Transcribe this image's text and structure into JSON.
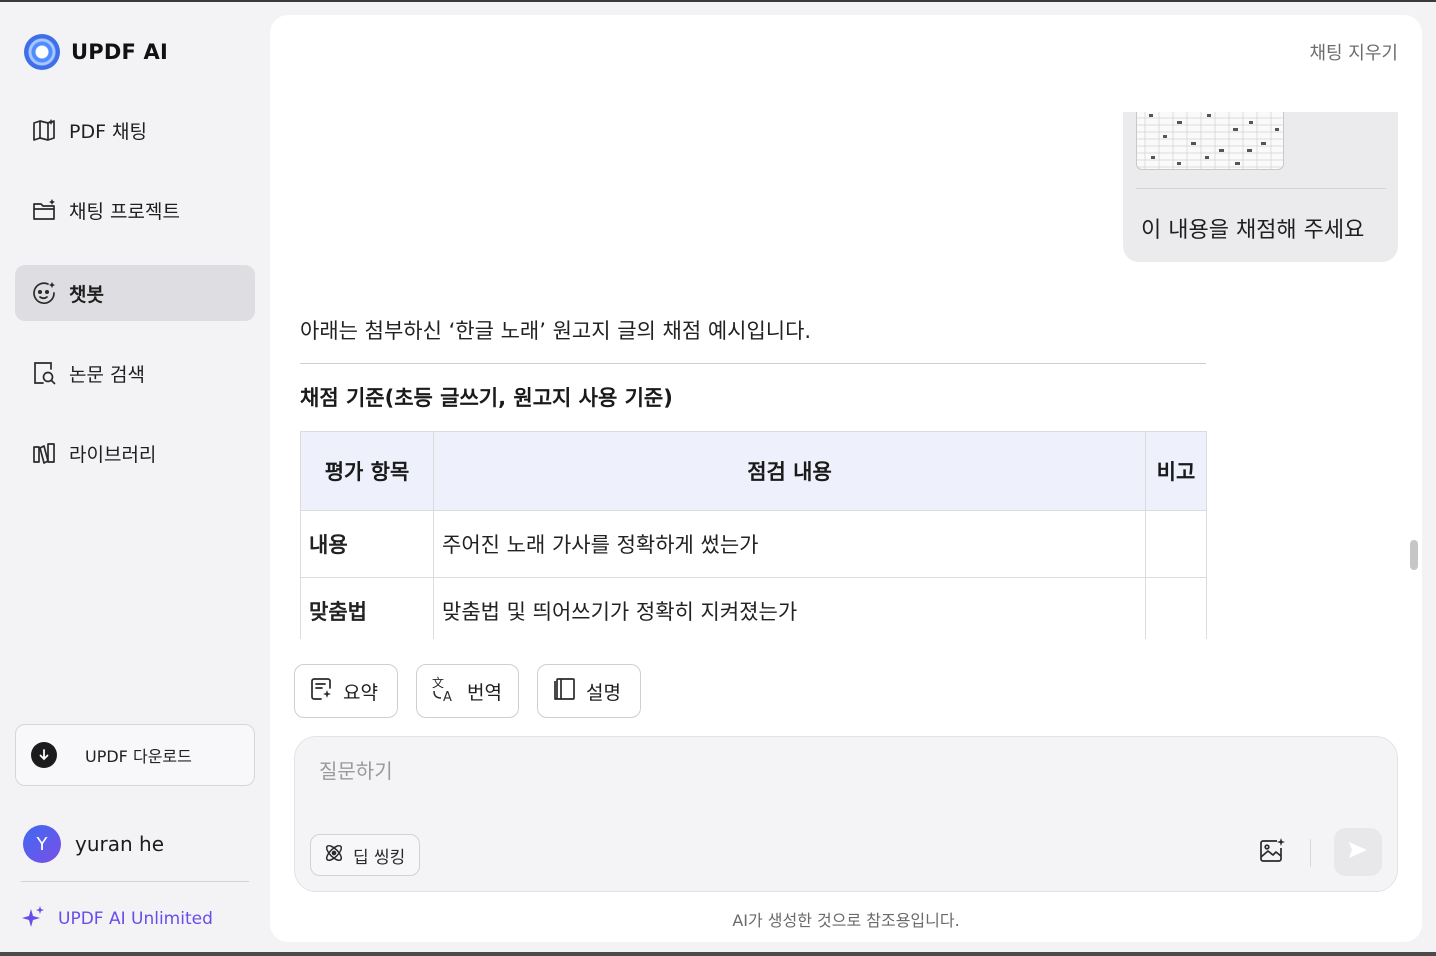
{
  "app": {
    "name": "UPDF AI"
  },
  "sidebar": {
    "items": [
      {
        "label": "PDF 채팅",
        "icon": "book-open-icon"
      },
      {
        "label": "채팅 프로젝트",
        "icon": "folder-sparkle-icon"
      },
      {
        "label": "챗봇",
        "icon": "chatbot-face-icon",
        "active": true
      },
      {
        "label": "논문 검색",
        "icon": "paper-search-icon"
      },
      {
        "label": "라이브러리",
        "icon": "library-books-icon"
      }
    ],
    "download_label": "UPDF 다운로드",
    "user": {
      "initial": "Y",
      "name": "yuran he"
    },
    "unlimited_label": "UPDF AI Unlimited"
  },
  "header": {
    "clear_label": "채팅 지우기"
  },
  "chat": {
    "user_message": "이 내용을 채점해 주세요",
    "answer_intro": "아래는 첨부하신 ‘한글 노래’ 원고지 글의 채점 예시입니다.",
    "criteria_title": "채점 기준(초등 글쓰기, 원고지 사용 기준)",
    "table": {
      "headers": [
        "평가 항목",
        "점검 내용",
        "비고"
      ],
      "rows": [
        [
          "내용",
          "주어진 노래 가사를 정확하게 썼는가",
          ""
        ],
        [
          "맞춤법",
          "맞춤법 및 띄어쓰기가 정확히 지켜졌는가",
          ""
        ]
      ]
    }
  },
  "quick_actions": [
    {
      "label": "요약",
      "icon": "summary-sparkle-icon"
    },
    {
      "label": "번역",
      "icon": "translate-icon"
    },
    {
      "label": "설명",
      "icon": "book-icon"
    }
  ],
  "composer": {
    "placeholder": "질문하기",
    "deep_thinking_label": "딥 씽킹"
  },
  "footer": {
    "disclaimer": "AI가 생성한 것으로 참조용입니다."
  },
  "colors": {
    "accent": "#6a4ce8",
    "active_nav": "#dedee2",
    "table_header": "#eef0fb"
  }
}
